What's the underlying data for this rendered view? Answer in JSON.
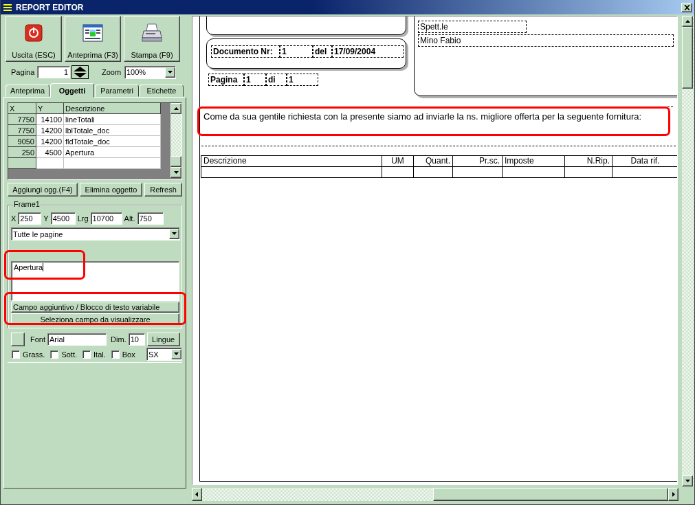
{
  "window": {
    "title": "REPORT EDITOR"
  },
  "toolbar": [
    {
      "label": "Uscita (ESC)",
      "kind": "exit"
    },
    {
      "label": "Anteprima (F3)",
      "kind": "preview"
    },
    {
      "label": "Stampa (F9)",
      "kind": "print"
    }
  ],
  "page_control": {
    "label": "Pagina",
    "value": "1"
  },
  "zoom": {
    "label": "Zoom",
    "value": "100%"
  },
  "tabs": [
    {
      "label": "Anteprima",
      "selected": false
    },
    {
      "label": "Oggetti",
      "selected": true
    },
    {
      "label": "Parametri",
      "selected": false
    },
    {
      "label": "Etichette",
      "selected": false
    }
  ],
  "objects_table": {
    "columns": [
      "X",
      "Y",
      "Descrizione"
    ],
    "rows": [
      [
        "7750",
        "14100",
        "lineTotali"
      ],
      [
        "7750",
        "14200",
        "lblTotale_doc"
      ],
      [
        "9050",
        "14200",
        "fldTotale_doc"
      ],
      [
        "250",
        "4500",
        "Apertura"
      ]
    ]
  },
  "object_buttons": [
    "Aggiungi ogg.(F4)",
    "Elimina oggetto",
    "Refresh"
  ],
  "frame": {
    "title": "Frame1",
    "fields": [
      {
        "label": "X",
        "value": "250"
      },
      {
        "label": "Y",
        "value": "4500"
      },
      {
        "label": "Lrg",
        "value": "10700"
      },
      {
        "label": "Alt.",
        "value": "750"
      }
    ],
    "pages": "Tutte le pagine",
    "text": {
      "value": "Apertura",
      "highlighted": true
    },
    "variable_block": {
      "label": "Campo aggiuntivo / Blocco di testo variabile",
      "button": "Seleziona campo da visualizzare",
      "highlighted": true
    },
    "font_label": "Font",
    "font": "Arial",
    "size_label": "Dim.",
    "size": "10",
    "languages_button": "Lingue",
    "styles": [
      {
        "label": "Grass.",
        "checked": false
      },
      {
        "label": "Sott.",
        "checked": false
      },
      {
        "label": "Ital.",
        "checked": false
      },
      {
        "label": "Box",
        "checked": false
      }
    ],
    "align": "SX"
  },
  "report": {
    "document": {
      "label": "Documento Nr:",
      "number": "1",
      "date_label": "del",
      "date": "17/09/2004"
    },
    "page_line": {
      "label": "Pagina",
      "value": "1",
      "of_label": "di",
      "total": "1"
    },
    "address": [
      "Spett.le",
      "Mino Fabio"
    ],
    "intro": {
      "text": "Come da sua gentile richiesta con la presente siamo ad inviarle la ns. migliore offerta per la seguente fornitura:",
      "highlighted": true
    },
    "table_columns": [
      "Descrizione",
      "UM",
      "Quant.",
      "Pr.sc.",
      "Imposte",
      "N.Rip.",
      "Data rif."
    ]
  }
}
